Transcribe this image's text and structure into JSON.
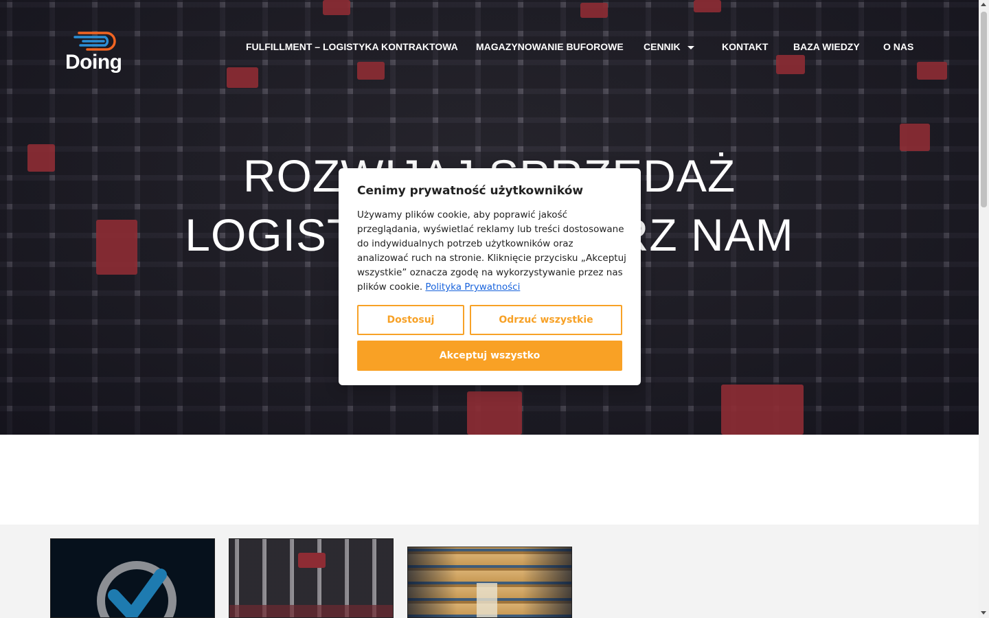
{
  "logo": {
    "text": "Doing",
    "icon": "doing-logo-icon",
    "colors": [
      "#f26522",
      "#2b8fd6"
    ]
  },
  "nav": {
    "items": [
      {
        "label": "FULFILLMENT – LOGISTYKA KONTRAKTOWA"
      },
      {
        "label": "MAGAZYNOWANIE BUFOROWE"
      },
      {
        "label": "CENNIK",
        "has_dropdown": true
      },
      {
        "label": "KONTAKT"
      },
      {
        "label": "BAZA WIEDZY"
      },
      {
        "label": "O NAS"
      }
    ]
  },
  "hero": {
    "line1": "ROZWIJAJ SPRZEDAŻ",
    "line2": "LOGISTYKĘ POWIERZ NAM"
  },
  "cookie_modal": {
    "title": "Cenimy prywatność użytkowników",
    "body": "Używamy plików cookie, aby poprawić jakość przeglądania, wyświetlać reklamy lub treści dostosowane do indywidualnych potrzeb użytkowników oraz analizować ruch na stronie. Kliknięcie przycisku „Akceptuj wszystkie” oznacza zgodę na wykorzystywanie przez nas plików cookie.",
    "policy_link": "Polityka Prywatności",
    "buttons": {
      "customize": "Dostosuj",
      "reject": "Odrzuć wszystkie",
      "accept": "Akceptuj wszystko"
    },
    "accent_color": "#f9a125",
    "link_color": "#1863dc"
  },
  "cards": [
    {
      "icon": "quality-badge-check-icon"
    },
    {
      "icon": "warehouse-robots-image"
    },
    {
      "icon": "warehouse-aisle-image"
    }
  ]
}
